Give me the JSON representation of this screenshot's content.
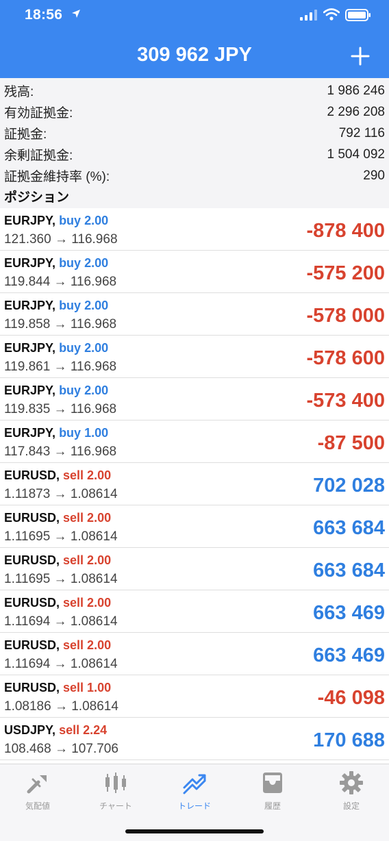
{
  "status_bar": {
    "time": "18:56"
  },
  "header": {
    "title": "309 962 JPY"
  },
  "summary": [
    {
      "label": "残高:",
      "value": "1 986 246"
    },
    {
      "label": "有効証拠金:",
      "value": "2 296 208"
    },
    {
      "label": "証拠金:",
      "value": "792 116"
    },
    {
      "label": "余剰証拠金:",
      "value": "1 504 092"
    },
    {
      "label": "証拠金維持率 (%):",
      "value": "290"
    }
  ],
  "positions_header": "ポジション",
  "positions": [
    {
      "symbol": "EURJPY,",
      "side": "buy 2.00",
      "prices": "121.360 → 116.968",
      "profit": "-878 400"
    },
    {
      "symbol": "EURJPY,",
      "side": "buy 2.00",
      "prices": "119.844 → 116.968",
      "profit": "-575 200"
    },
    {
      "symbol": "EURJPY,",
      "side": "buy 2.00",
      "prices": "119.858 → 116.968",
      "profit": "-578 000"
    },
    {
      "symbol": "EURJPY,",
      "side": "buy 2.00",
      "prices": "119.861 → 116.968",
      "profit": "-578 600"
    },
    {
      "symbol": "EURJPY,",
      "side": "buy 2.00",
      "prices": "119.835 → 116.968",
      "profit": "-573 400"
    },
    {
      "symbol": "EURJPY,",
      "side": "buy 1.00",
      "prices": "117.843 → 116.968",
      "profit": "-87 500"
    },
    {
      "symbol": "EURUSD,",
      "side": "sell 2.00",
      "prices": "1.11873 → 1.08614",
      "profit": "702 028"
    },
    {
      "symbol": "EURUSD,",
      "side": "sell 2.00",
      "prices": "1.11695 → 1.08614",
      "profit": "663 684"
    },
    {
      "symbol": "EURUSD,",
      "side": "sell 2.00",
      "prices": "1.11695 → 1.08614",
      "profit": "663 684"
    },
    {
      "symbol": "EURUSD,",
      "side": "sell 2.00",
      "prices": "1.11694 → 1.08614",
      "profit": "663 469"
    },
    {
      "symbol": "EURUSD,",
      "side": "sell 2.00",
      "prices": "1.11694 → 1.08614",
      "profit": "663 469"
    },
    {
      "symbol": "EURUSD,",
      "side": "sell 1.00",
      "prices": "1.08186 → 1.08614",
      "profit": "-46 098"
    },
    {
      "symbol": "USDJPY,",
      "side": "sell 2.24",
      "prices": "108.468 → 107.706",
      "profit": "170 688"
    }
  ],
  "tabs": [
    {
      "label": "気配値",
      "icon": "quotes-icon"
    },
    {
      "label": "チャート",
      "icon": "chart-icon"
    },
    {
      "label": "トレード",
      "icon": "trade-icon"
    },
    {
      "label": "履歴",
      "icon": "history-icon"
    },
    {
      "label": "設定",
      "icon": "settings-icon"
    }
  ],
  "colors": {
    "accent": "#3b87f0",
    "buy": "#2f7fe0",
    "sell": "#d8432f",
    "loss": "#d8432f",
    "gain": "#2f7fe0"
  }
}
